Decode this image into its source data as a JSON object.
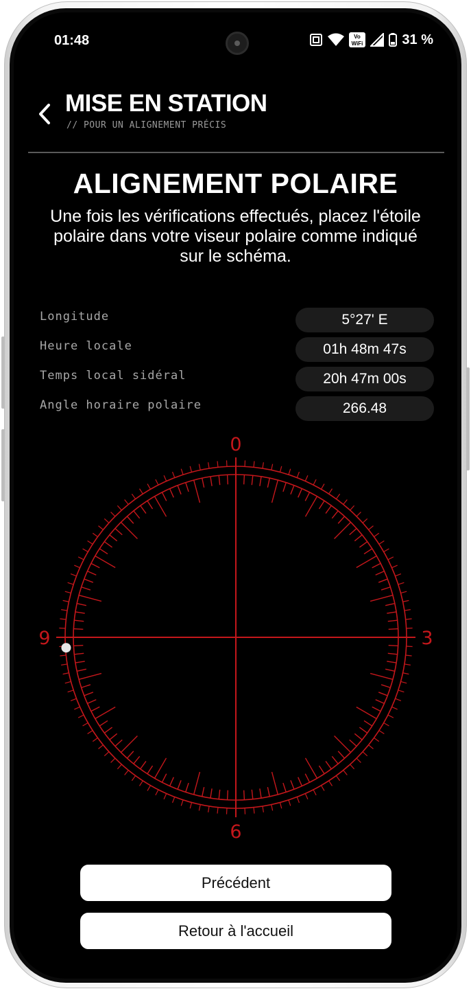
{
  "status_bar": {
    "time": "01:48",
    "battery_text": "31 %",
    "icons": [
      "nfc-icon",
      "wifi-icon",
      "vowifi-icon",
      "signal-icon",
      "battery-icon"
    ],
    "vowifi_top": "Vo",
    "vowifi_bottom": "WiFi"
  },
  "header": {
    "back_icon": "chevron-left-icon",
    "title": "MISE EN STATION",
    "subtitle": "// POUR UN ALIGNEMENT PRÉCIS"
  },
  "section": {
    "title": "ALIGNEMENT POLAIRE",
    "description": "Une fois les vérifications effectués, placez l'étoile polaire dans votre viseur polaire comme indiqué sur le schéma."
  },
  "info": [
    {
      "label": "Longitude",
      "value": "5°27' E"
    },
    {
      "label": "Heure locale",
      "value": "01h 48m 47s"
    },
    {
      "label": "Temps local sidéral",
      "value": "20h 47m 00s"
    },
    {
      "label": "Angle horaire polaire",
      "value": "266.48"
    }
  ],
  "reticle": {
    "labels": {
      "top": "0",
      "right": "3",
      "bottom": "6",
      "left": "9"
    },
    "hour_angle": 266.48,
    "color": "#c4171b",
    "star_color": "#e6e6e6"
  },
  "buttons": {
    "previous": "Précédent",
    "home": "Retour à l'accueil"
  }
}
